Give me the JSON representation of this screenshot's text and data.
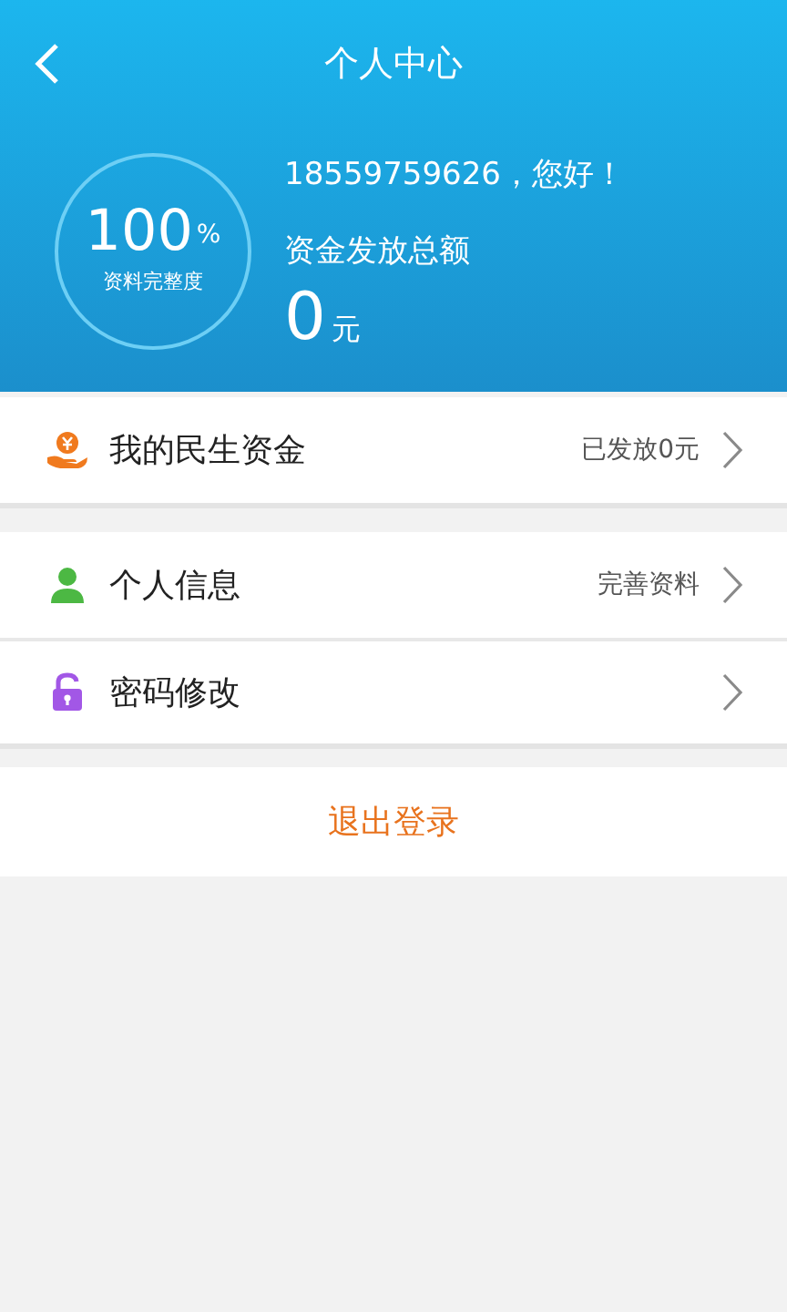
{
  "header": {
    "title": "个人中心"
  },
  "profile": {
    "completeness": {
      "value": "100",
      "unit": "%",
      "label": "资料完整度"
    },
    "greeting": "18559759626，您好！",
    "total_label": "资金发放总额",
    "total_value": "0",
    "total_unit": "元"
  },
  "menu_groups": [
    [
      {
        "kind": "money",
        "color": "#f07a1e",
        "label": "我的民生资金",
        "detail": "已发放0元"
      }
    ],
    [
      {
        "kind": "person",
        "color": "#4cb843",
        "label": "个人信息",
        "detail": "完善资料"
      },
      {
        "kind": "lock",
        "color": "#a257e6",
        "label": "密码修改"
      }
    ]
  ],
  "logout": "退出登录"
}
